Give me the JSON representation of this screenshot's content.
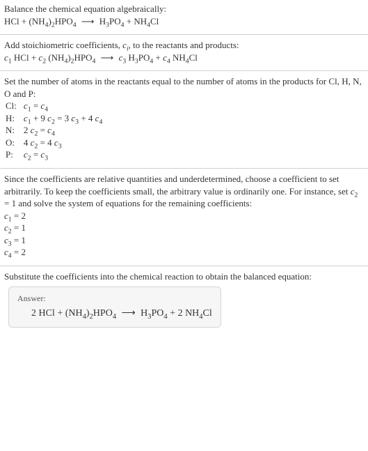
{
  "s1": {
    "intro": "Balance the chemical equation algebraically:",
    "eq_lhs1": "HCl + (NH",
    "eq_lhs2": ")",
    "eq_lhs3": "HPO",
    "eq_arrow": "⟶",
    "eq_rhs1": "H",
    "eq_rhs2": "PO",
    "eq_rhs3": " + NH",
    "eq_rhs4": "Cl"
  },
  "s2": {
    "intro_a": "Add stoichiometric coefficients, ",
    "ci": "c",
    "ci_sub": "i",
    "intro_b": ", to the reactants and products:",
    "c1": "c",
    "c1s": "1",
    "sp1": " HCl + ",
    "c2": "c",
    "c2s": "2",
    "sp2": " (NH",
    "sp3": ")",
    "sp4": "HPO",
    "arrow": "⟶",
    "c3": "c",
    "c3s": "3",
    "sp5": " H",
    "sp6": "PO",
    "sp7": " + ",
    "c4": "c",
    "c4s": "4",
    "sp8": " NH",
    "sp9": "Cl"
  },
  "s3": {
    "intro": "Set the number of atoms in the reactants equal to the number of atoms in the products for Cl, H, N, O and P:",
    "rows": [
      {
        "label": "Cl:",
        "pre": "",
        "c_a": "c",
        "s_a": "1",
        "mid": " = ",
        "c_b": "c",
        "s_b": "4",
        "post": ""
      },
      {
        "label": "H:",
        "pre": "",
        "c_a": "c",
        "s_a": "1",
        "mid": " + 9 ",
        "c_b": "c",
        "s_b": "2",
        "mid2": " = 3 ",
        "c_c": "c",
        "s_c": "3",
        "mid3": " + 4 ",
        "c_d": "c",
        "s_d": "4"
      },
      {
        "label": "N:",
        "pre": "2 ",
        "c_a": "c",
        "s_a": "2",
        "mid": " = ",
        "c_b": "c",
        "s_b": "4",
        "post": ""
      },
      {
        "label": "O:",
        "pre": "4 ",
        "c_a": "c",
        "s_a": "2",
        "mid": " = 4 ",
        "c_b": "c",
        "s_b": "3",
        "post": ""
      },
      {
        "label": "P:",
        "pre": "",
        "c_a": "c",
        "s_a": "2",
        "mid": " = ",
        "c_b": "c",
        "s_b": "3",
        "post": ""
      }
    ]
  },
  "s4": {
    "intro_a": "Since the coefficients are relative quantities and underdetermined, choose a coefficient to set arbitrarily. To keep the coefficients small, the arbitrary value is ordinarily one. For instance, set ",
    "c2": "c",
    "c2s": "2",
    "intro_b": " = 1 and solve the system of equations for the remaining coefficients:",
    "lines": [
      {
        "c": "c",
        "s": "1",
        "v": " = 2"
      },
      {
        "c": "c",
        "s": "2",
        "v": " = 1"
      },
      {
        "c": "c",
        "s": "3",
        "v": " = 1"
      },
      {
        "c": "c",
        "s": "4",
        "v": " = 2"
      }
    ]
  },
  "s5": {
    "intro": "Substitute the coefficients into the chemical reaction to obtain the balanced equation:",
    "answer_label": "Answer:",
    "eq_a": "2 HCl + (NH",
    "eq_b": ")",
    "eq_c": "HPO",
    "arrow": "⟶",
    "eq_d": "H",
    "eq_e": "PO",
    "eq_f": " + 2 NH",
    "eq_g": "Cl"
  },
  "sub4": "4",
  "sub2": "2",
  "sub3": "3"
}
